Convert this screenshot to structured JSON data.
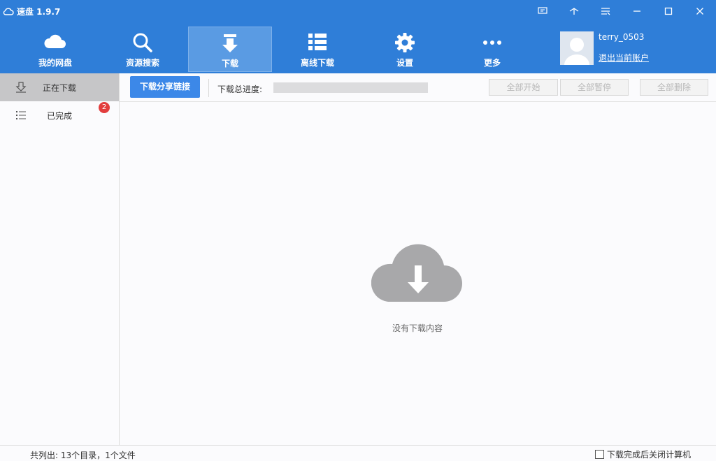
{
  "app": {
    "title": "速盘 1.9.7"
  },
  "titlebar": {
    "buttons": [
      {
        "name": "chat-icon"
      },
      {
        "name": "skin-icon"
      },
      {
        "name": "menu-icon"
      },
      {
        "name": "minimize-icon"
      },
      {
        "name": "maximize-icon"
      },
      {
        "name": "close-icon"
      }
    ]
  },
  "nav": {
    "items": [
      {
        "label": "我的网盘",
        "icon": "cloud-icon"
      },
      {
        "label": "资源搜索",
        "icon": "search-icon"
      },
      {
        "label": "下载",
        "icon": "download-icon",
        "active": true
      },
      {
        "label": "离线下载",
        "icon": "list-icon"
      },
      {
        "label": "设置",
        "icon": "gear-icon"
      },
      {
        "label": "更多",
        "icon": "more-icon"
      }
    ]
  },
  "user": {
    "name": "terry_0503",
    "logout": "退出当前账户"
  },
  "sidebar": {
    "items": [
      {
        "label": "正在下载",
        "icon": "download-tray-icon",
        "active": true
      },
      {
        "label": "已完成",
        "icon": "list-icon",
        "badge": "2"
      }
    ]
  },
  "toolbar": {
    "share_button": "下载分享链接",
    "progress_label": "下载总进度:",
    "progress_value": 0,
    "start_all": "全部开始",
    "pause_all": "全部暂停",
    "delete_all": "全部删除"
  },
  "main": {
    "empty_text": "没有下载内容"
  },
  "status": {
    "summary": "共列出: 13个目录，1个文件",
    "shutdown_label": "下载完成后关闭计算机",
    "shutdown_checked": false
  },
  "colors": {
    "accent": "#2f7ed8",
    "button": "#3c88e8",
    "badge": "#e23d3d"
  }
}
